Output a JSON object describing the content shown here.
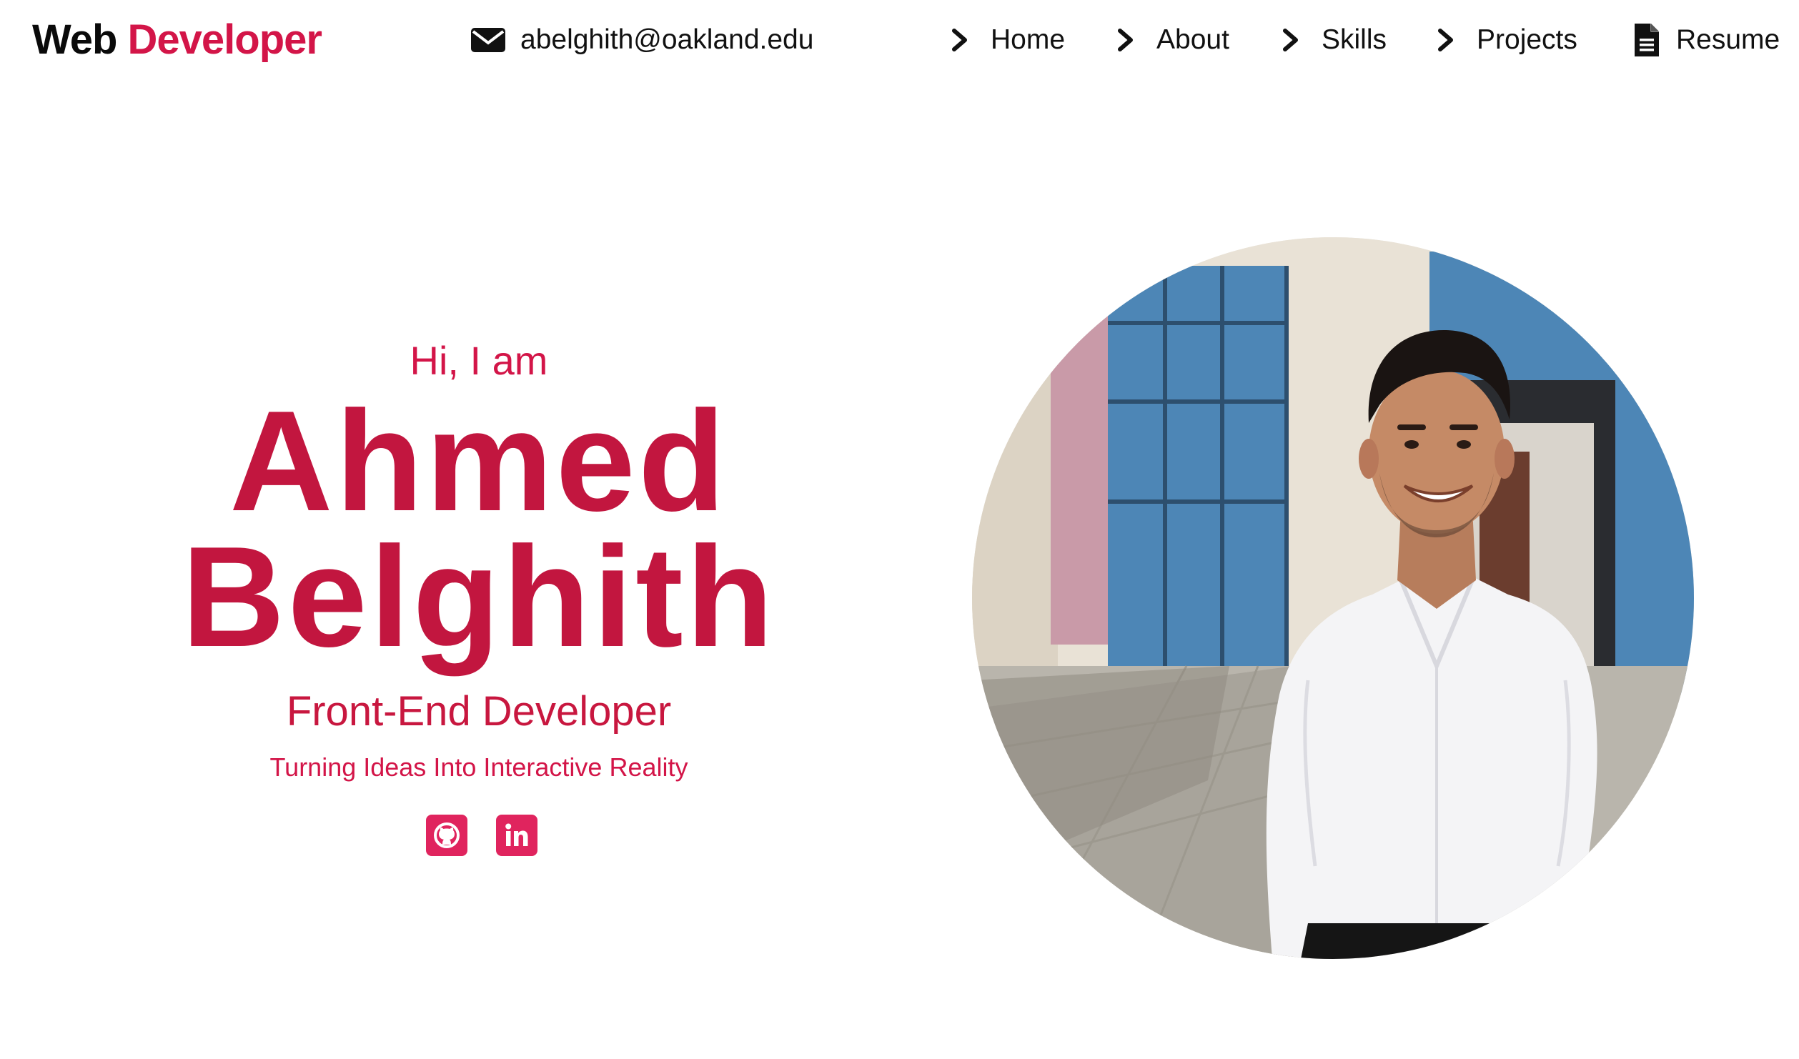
{
  "header": {
    "brand_word1": "Web",
    "brand_word2": "Developer",
    "email": "abelghith@oakland.edu",
    "nav": [
      {
        "label": "Home",
        "icon": "chevron-right-icon"
      },
      {
        "label": "About",
        "icon": "chevron-right-icon"
      },
      {
        "label": "Skills",
        "icon": "chevron-right-icon"
      },
      {
        "label": "Projects",
        "icon": "chevron-right-icon"
      },
      {
        "label": "Resume",
        "icon": "document-icon"
      }
    ]
  },
  "hero": {
    "greeting": "Hi, I am",
    "first_name": "Ahmed",
    "last_name": "Belghith",
    "role": "Front-End Developer",
    "tagline": "Turning Ideas Into Interactive Reality",
    "socials": [
      {
        "icon": "github-icon"
      },
      {
        "icon": "linkedin-icon"
      }
    ]
  },
  "colors": {
    "accent": "#d31548",
    "name": "#c2163f",
    "social_bg": "#e0245e",
    "text": "#111111"
  }
}
